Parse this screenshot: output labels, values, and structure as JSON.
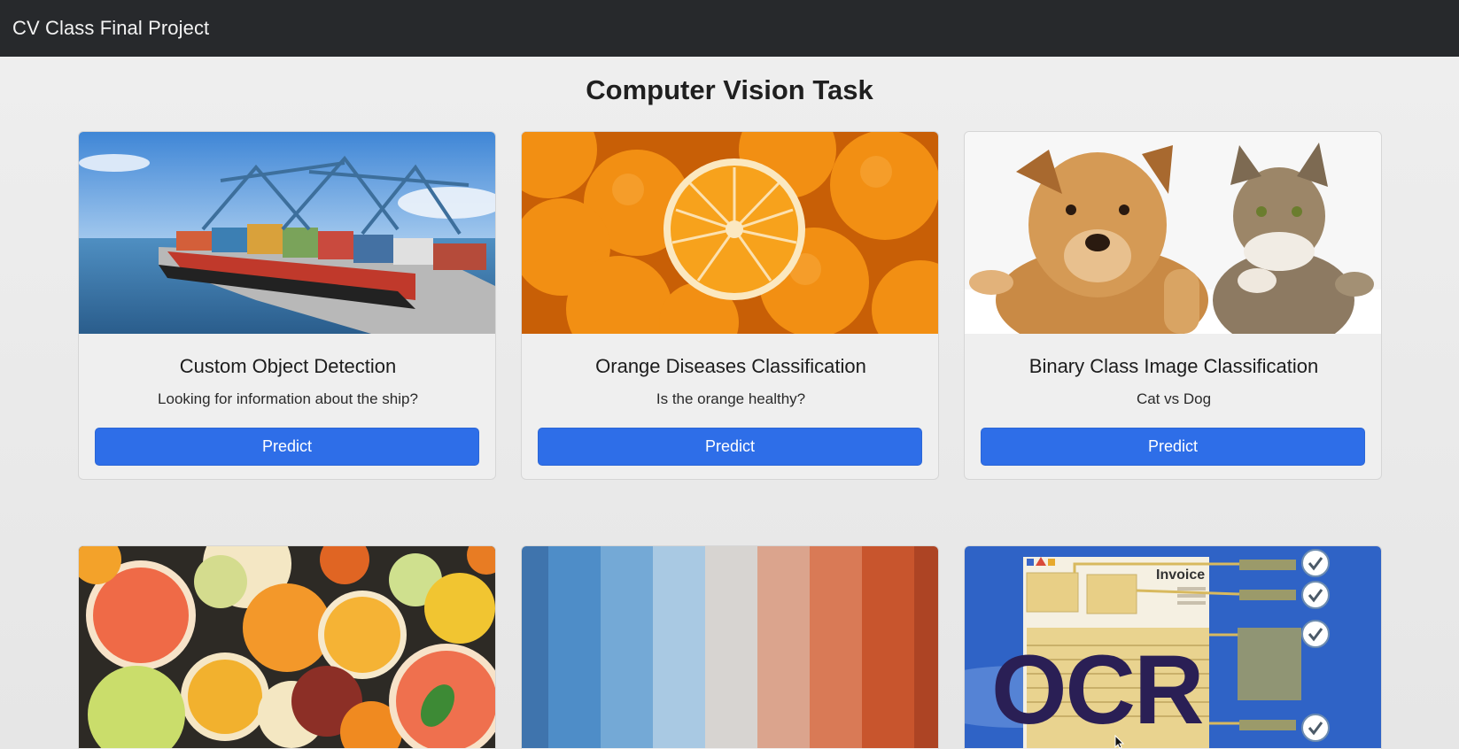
{
  "navbar": {
    "brand": "CV Class Final Project"
  },
  "page": {
    "title": "Computer Vision Task"
  },
  "cards": [
    {
      "title": "Custom Object Detection",
      "text": "Looking for information about the ship?",
      "button": "Predict",
      "image": "cargo-ship-port"
    },
    {
      "title": "Orange Diseases Classification",
      "text": "Is the orange healthy?",
      "button": "Predict",
      "image": "oranges"
    },
    {
      "title": "Binary Class Image Classification",
      "text": "Cat vs Dog",
      "button": "Predict",
      "image": "dog-and-cat"
    }
  ],
  "cards_row2": [
    {
      "image": "citrus-fruits"
    },
    {
      "image": "color-stripes"
    },
    {
      "image": "ocr-invoice",
      "overlay_text": "OCR",
      "doc_label": "Invoice"
    }
  ],
  "colors": {
    "navbar": "#27292c",
    "button": "#2e6ee8",
    "ocr_background": "#2f63c6"
  }
}
